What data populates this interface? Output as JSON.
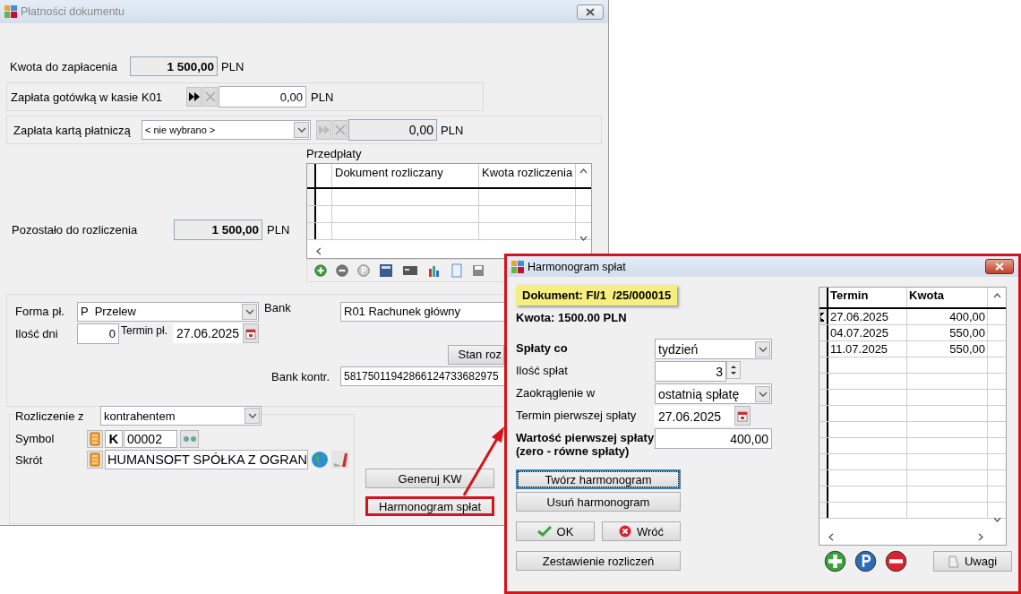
{
  "main_window": {
    "title": "Płatności dokumentu",
    "amount_due": {
      "label": "Kwota do zapłacenia",
      "value": "1 500,00",
      "currency": "PLN"
    },
    "cash": {
      "label": "Zapłata gotówką w kasie K01",
      "value": "0,00",
      "currency": "PLN"
    },
    "card": {
      "label": "Zapłata kartą płatniczą",
      "select": "< nie wybrano >",
      "value": "0,00",
      "currency": "PLN"
    },
    "remaining": {
      "label": "Pozostało do rozliczenia",
      "value": "1 500,00",
      "currency": "PLN"
    },
    "prepayments": {
      "title": "Przedpłaty",
      "columns": [
        "Dokument rozliczany",
        "Kwota rozliczenia"
      ]
    },
    "payment": {
      "form_label": "Forma pł.",
      "form_value": "P  Przelew",
      "days_label": "Ilość dni",
      "days_value": "0",
      "due_label": "Termin pł.",
      "due_value": "27.06.2025",
      "bank_label": "Bank",
      "bank_value": "R01 Rachunek główny",
      "status_button": "Stan roz",
      "bank_contr_label": "Bank kontr.",
      "bank_contr_value": "58175011942866124733682975"
    },
    "settlement": {
      "label": "Rozliczenie z",
      "value": "kontrahentem",
      "symbol_label": "Symbol",
      "symbol_prefix": "K",
      "symbol_value": "00002",
      "short_label": "Skrót",
      "short_value": "HUMANSOFT SPÓŁKA Z OGRAN"
    },
    "buttons": [
      {
        "label": "Generuj KW",
        "highlighted": false
      },
      {
        "label": "Harmonogram spłat",
        "highlighted": true
      }
    ]
  },
  "dialog": {
    "title": "Harmonogram spłat",
    "highlighted": true,
    "document": "Dokument: FI/1  /25/000015",
    "amount": "Kwota: 1500.00 PLN",
    "fields": [
      {
        "kind": "select",
        "label": "Spłaty co",
        "value": "tydzień",
        "bold": true
      },
      {
        "kind": "spin",
        "label": "Ilość spłat",
        "value": "3",
        "bold": false
      },
      {
        "kind": "select",
        "label": "Zaokrąglenie w",
        "value": "ostatnią spłatę",
        "bold": false
      },
      {
        "kind": "date",
        "label": "Termin pierwszej spłaty",
        "value": "27.06.2025",
        "bold": false
      },
      {
        "kind": "number",
        "label": "Wartość pierwszej spłaty\n(zero - równe spłaty)",
        "value": "400,00",
        "bold": true
      }
    ],
    "actions": [
      {
        "kind": "wide",
        "label": "Twórz harmonogram",
        "focused": true
      },
      {
        "kind": "wide",
        "label": "Usuń harmonogram",
        "focused": false
      }
    ],
    "ok": "OK",
    "back": "Wróć",
    "summary": "Zestawienie rozliczeń",
    "table": {
      "columns": [
        "Termin",
        "Kwota"
      ],
      "rows": [
        {
          "date": "27.06.2025",
          "amount": "400,00",
          "selected": true
        },
        {
          "date": "04.07.2025",
          "amount": "550,00",
          "selected": false
        },
        {
          "date": "11.07.2025",
          "amount": "550,00",
          "selected": false
        }
      ]
    },
    "notes_button": "Uwagi"
  }
}
